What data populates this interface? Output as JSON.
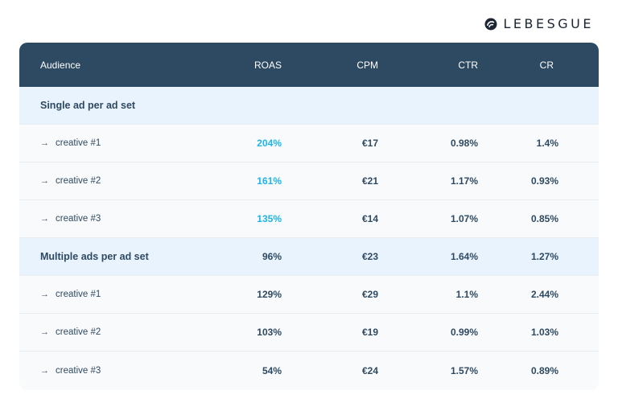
{
  "brand": {
    "name": "LEBESGUE",
    "icon": "lebesgue-logo-icon"
  },
  "table": {
    "headers": [
      "Audience",
      "ROAS",
      "CPM",
      "CTR",
      "CR"
    ],
    "colors": {
      "header_bg": "#2e4a62",
      "group_bg": "#e9f3fd",
      "highlight": "#1fb4e6",
      "text": "#2e4a62"
    },
    "groups": [
      {
        "label": "Single ad per ad set",
        "values": [
          "",
          "",
          "",
          ""
        ],
        "rows": [
          {
            "label": "creative #1",
            "values": [
              "204%",
              "€17",
              "0.98%",
              "1.4%"
            ],
            "roas_highlight": true
          },
          {
            "label": "creative #2",
            "values": [
              "161%",
              "€21",
              "1.17%",
              "0.93%"
            ],
            "roas_highlight": true
          },
          {
            "label": "creative #3",
            "values": [
              "135%",
              "€14",
              "1.07%",
              "0.85%"
            ],
            "roas_highlight": true
          }
        ]
      },
      {
        "label": "Multiple ads per ad set",
        "values": [
          "96%",
          "€23",
          "1.64%",
          "1.27%"
        ],
        "rows": [
          {
            "label": "creative #1",
            "values": [
              "129%",
              "€29",
              "1.1%",
              "2.44%"
            ],
            "roas_highlight": false
          },
          {
            "label": "creative #2",
            "values": [
              "103%",
              "€19",
              "0.99%",
              "1.03%"
            ],
            "roas_highlight": false
          },
          {
            "label": "creative #3",
            "values": [
              "54%",
              "€24",
              "1.57%",
              "0.89%"
            ],
            "roas_highlight": false
          }
        ]
      }
    ],
    "arrow": "→"
  }
}
